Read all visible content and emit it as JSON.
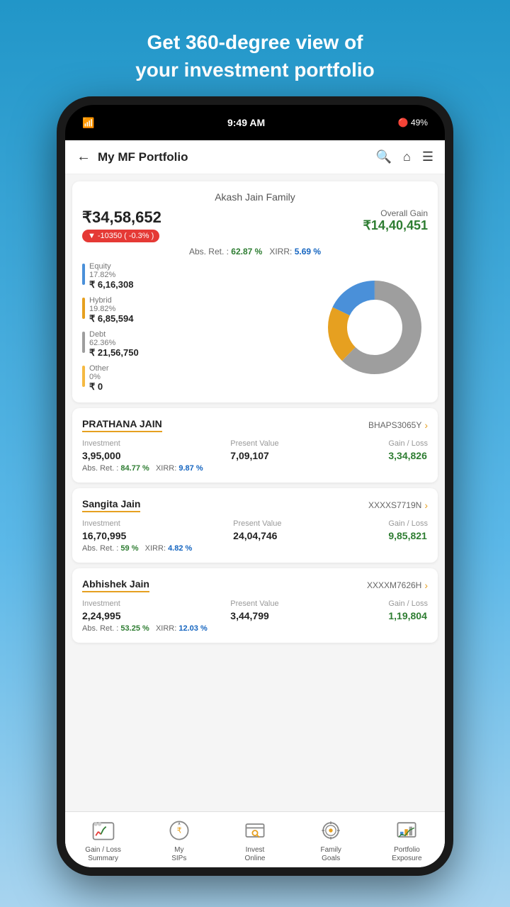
{
  "header": {
    "line1": "Get 360-degree view of",
    "line2": "your investment portfolio"
  },
  "status_bar": {
    "wifi": "WiFi",
    "time": "9:49 AM",
    "bluetooth": "49%"
  },
  "app_bar": {
    "back_icon": "back-arrow",
    "title": "My MF Portfolio",
    "search_icon": "search",
    "home_icon": "home",
    "menu_icon": "menu"
  },
  "portfolio": {
    "family_name": "Akash Jain Family",
    "total_value": "₹34,58,652",
    "change_amount": "-10350",
    "change_percent": "-0.3%",
    "overall_gain_label": "Overall Gain",
    "overall_gain_value": "₹14,40,451",
    "abs_ret_label": "Abs. Ret. :",
    "abs_ret_value": "62.87 %",
    "xirr_label": "XIRR:",
    "xirr_value": "5.69 %",
    "segments": [
      {
        "name": "Equity",
        "percent": "17.82%",
        "amount": "₹ 6,16,308",
        "color": "#4a90d9"
      },
      {
        "name": "Hybrid",
        "percent": "19.82%",
        "amount": "₹ 6,85,594",
        "color": "#e6a020"
      },
      {
        "name": "Debt",
        "percent": "62.36%",
        "amount": "₹ 21,56,750",
        "color": "#9e9e9e"
      },
      {
        "name": "Other",
        "percent": "0%",
        "amount": "₹ 0",
        "color": "#f5b942"
      }
    ]
  },
  "persons": [
    {
      "name": "PRATHANA JAIN",
      "id": "BHAPS3065Y",
      "investment_label": "Investment",
      "investment_value": "3,95,000",
      "present_value_label": "Present Value",
      "present_value": "7,09,107",
      "gain_loss_label": "Gain / Loss",
      "gain_loss": "3,34,826",
      "abs_ret_value": "84.77 %",
      "xirr_value": "9.87 %"
    },
    {
      "name": "Sangita Jain",
      "id": "XXXXS7719N",
      "investment_label": "Investment",
      "investment_value": "16,70,995",
      "present_value_label": "Present Value",
      "present_value": "24,04,746",
      "gain_loss_label": "Gain / Loss",
      "gain_loss": "9,85,821",
      "abs_ret_value": "59 %",
      "xirr_value": "4.82 %"
    },
    {
      "name": "Abhishek Jain",
      "id": "XXXXM7626H",
      "investment_label": "Investment",
      "investment_value": "2,24,995",
      "present_value_label": "Present Value",
      "present_value": "3,44,799",
      "gain_loss_label": "Gain / Loss",
      "gain_loss": "1,19,804",
      "abs_ret_value": "53.25 %",
      "xirr_value": "12.03 %"
    }
  ],
  "bottom_nav": [
    {
      "id": "gain-loss",
      "label": "Gain / Loss\nSummary",
      "icon": "chart-icon"
    },
    {
      "id": "my-sips",
      "label": "My\nSIPs",
      "icon": "sip-icon"
    },
    {
      "id": "invest-online",
      "label": "Invest\nOnline",
      "icon": "invest-icon"
    },
    {
      "id": "family-goals",
      "label": "Family\nGoals",
      "icon": "goals-icon"
    },
    {
      "id": "portfolio-exposure",
      "label": "Portfolio\nExposure",
      "icon": "exposure-icon"
    }
  ]
}
